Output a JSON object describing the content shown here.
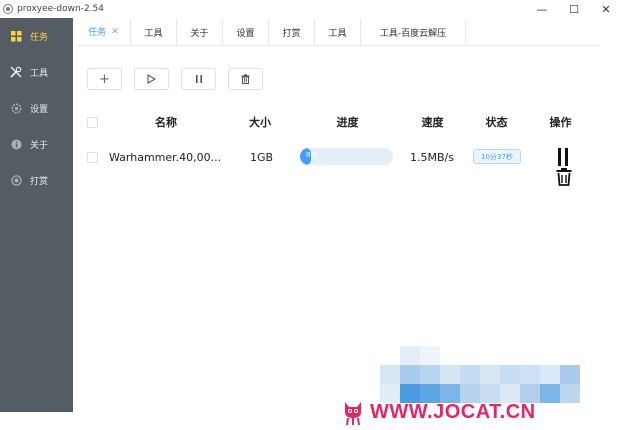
{
  "window": {
    "title": "proxyee-down-2.54",
    "controls": {
      "minimize": "—",
      "maximize": "☐",
      "close": "✕"
    }
  },
  "sidebar": {
    "items": [
      {
        "label": "任务",
        "icon": "grid-icon",
        "active": true
      },
      {
        "label": "工具",
        "icon": "tools-icon",
        "active": false
      },
      {
        "label": "设置",
        "icon": "gear-icon",
        "active": false
      },
      {
        "label": "关于",
        "icon": "info-icon",
        "active": false
      },
      {
        "label": "打赏",
        "icon": "donate-icon",
        "active": false
      }
    ]
  },
  "tabs": [
    {
      "label": "任务",
      "active": true,
      "closable": true
    },
    {
      "label": "工具",
      "active": false
    },
    {
      "label": "关于",
      "active": false
    },
    {
      "label": "设置",
      "active": false
    },
    {
      "label": "打赏",
      "active": false
    },
    {
      "label": "工具",
      "active": false
    },
    {
      "label": "工具-百度云解压",
      "active": false
    }
  ],
  "toolbar": {
    "buttons": [
      {
        "name": "add",
        "glyph": "+"
      },
      {
        "name": "start",
        "glyph": "▷"
      },
      {
        "name": "pause",
        "glyph": "II"
      },
      {
        "name": "delete",
        "glyph": "trash"
      }
    ]
  },
  "table": {
    "headers": {
      "name": "名称",
      "size": "大小",
      "progress": "进度",
      "speed": "速度",
      "status": "状态",
      "action": "操作"
    },
    "rows": [
      {
        "name": "Warhammer.40,00...",
        "size": "1GB",
        "progress": 0.08,
        "progress_text": "8%",
        "speed": "1.5MB/s",
        "status": "10分37秒"
      }
    ]
  },
  "watermark": {
    "text": "WWW.JOCAT.CN",
    "color": "#e6246b"
  },
  "colors": {
    "sidebar_bg": "#545c64",
    "sidebar_active": "#ffd04b",
    "accent": "#409eff"
  }
}
